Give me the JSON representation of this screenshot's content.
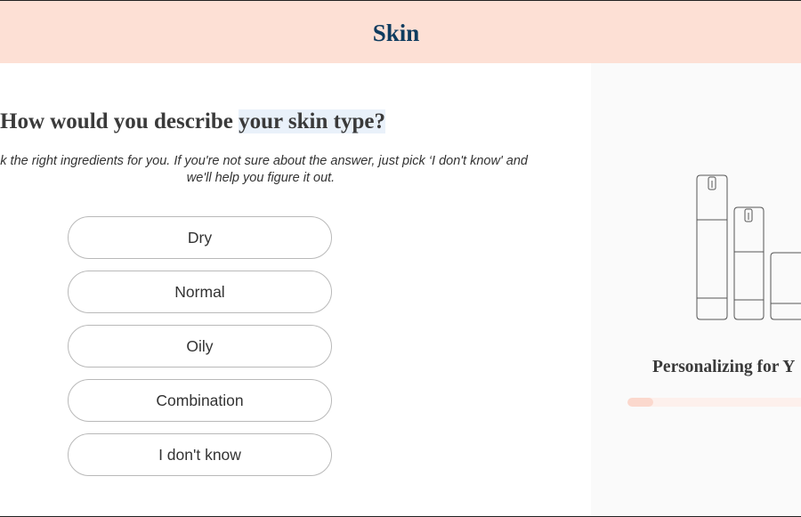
{
  "header": {
    "title": "Skin"
  },
  "quiz": {
    "question_prefix": "How would you describe ",
    "question_highlight": "your skin type?",
    "description": "ck the right ingredients for you. If you're not sure about the answer, just pick ‘I don't know' and we'll help you figure it out.",
    "options": [
      {
        "label": "Dry"
      },
      {
        "label": "Normal"
      },
      {
        "label": "Oily"
      },
      {
        "label": "Combination"
      },
      {
        "label": "I don't know"
      }
    ]
  },
  "sidebar": {
    "status_text": "Personalizing for Y",
    "progress_fraction": 0.12,
    "colors": {
      "panel_bg": "#fafafa",
      "progress_track": "#fdf0ec",
      "progress_fill": "#fbd8cd"
    },
    "illustration_icon": "skincare-bottles-icon"
  },
  "colors": {
    "header_bg": "#fde0d5",
    "header_title": "#0f3c5f",
    "question_highlight_bg": "#e9f1fa",
    "option_border": "#b9b9b9"
  }
}
